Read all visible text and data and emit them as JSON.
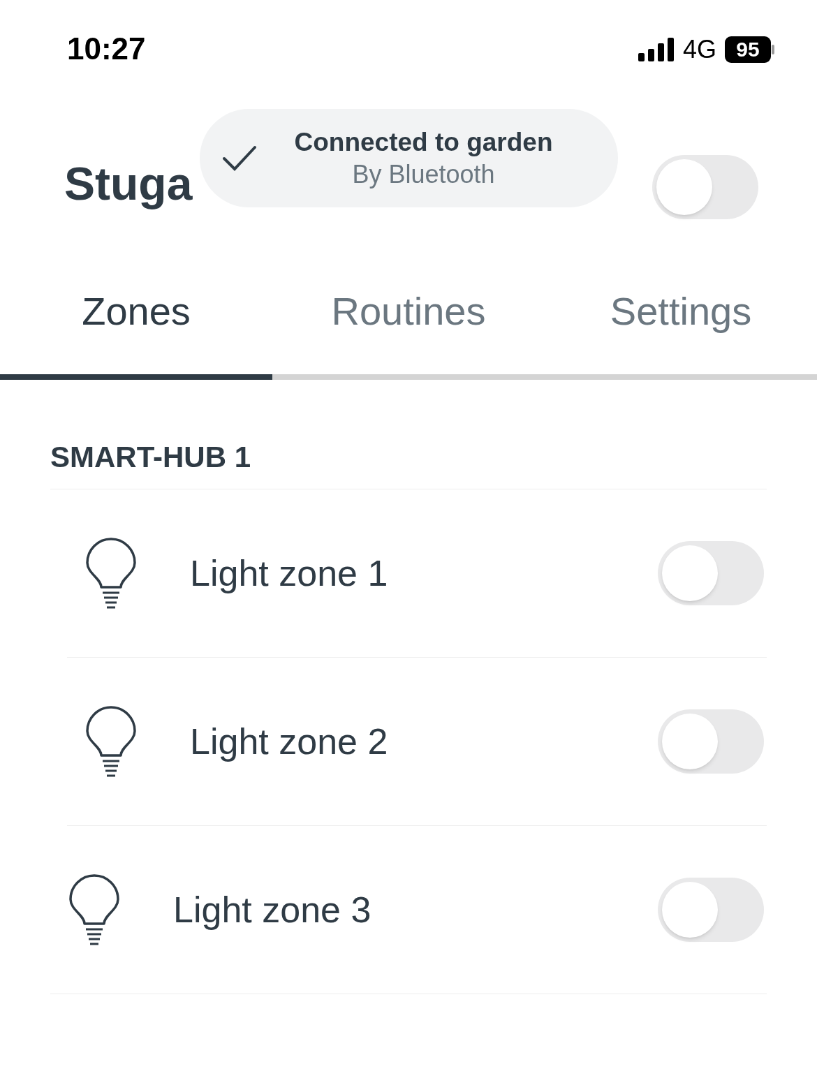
{
  "status_bar": {
    "time": "10:27",
    "network": "4G",
    "battery": "95"
  },
  "header": {
    "title": "Stuga",
    "toggle_on": false
  },
  "toast": {
    "title": "Connected to garden",
    "subtitle": "By Bluetooth"
  },
  "tabs": [
    {
      "label": "Zones",
      "selected": true
    },
    {
      "label": "Routines",
      "selected": false
    },
    {
      "label": "Settings",
      "selected": false
    }
  ],
  "section": {
    "title": "SMART-HUB 1",
    "zones": [
      {
        "label": "Light zone 1",
        "on": false
      },
      {
        "label": "Light zone 2",
        "on": false
      },
      {
        "label": "Light zone 3",
        "on": false
      }
    ]
  }
}
